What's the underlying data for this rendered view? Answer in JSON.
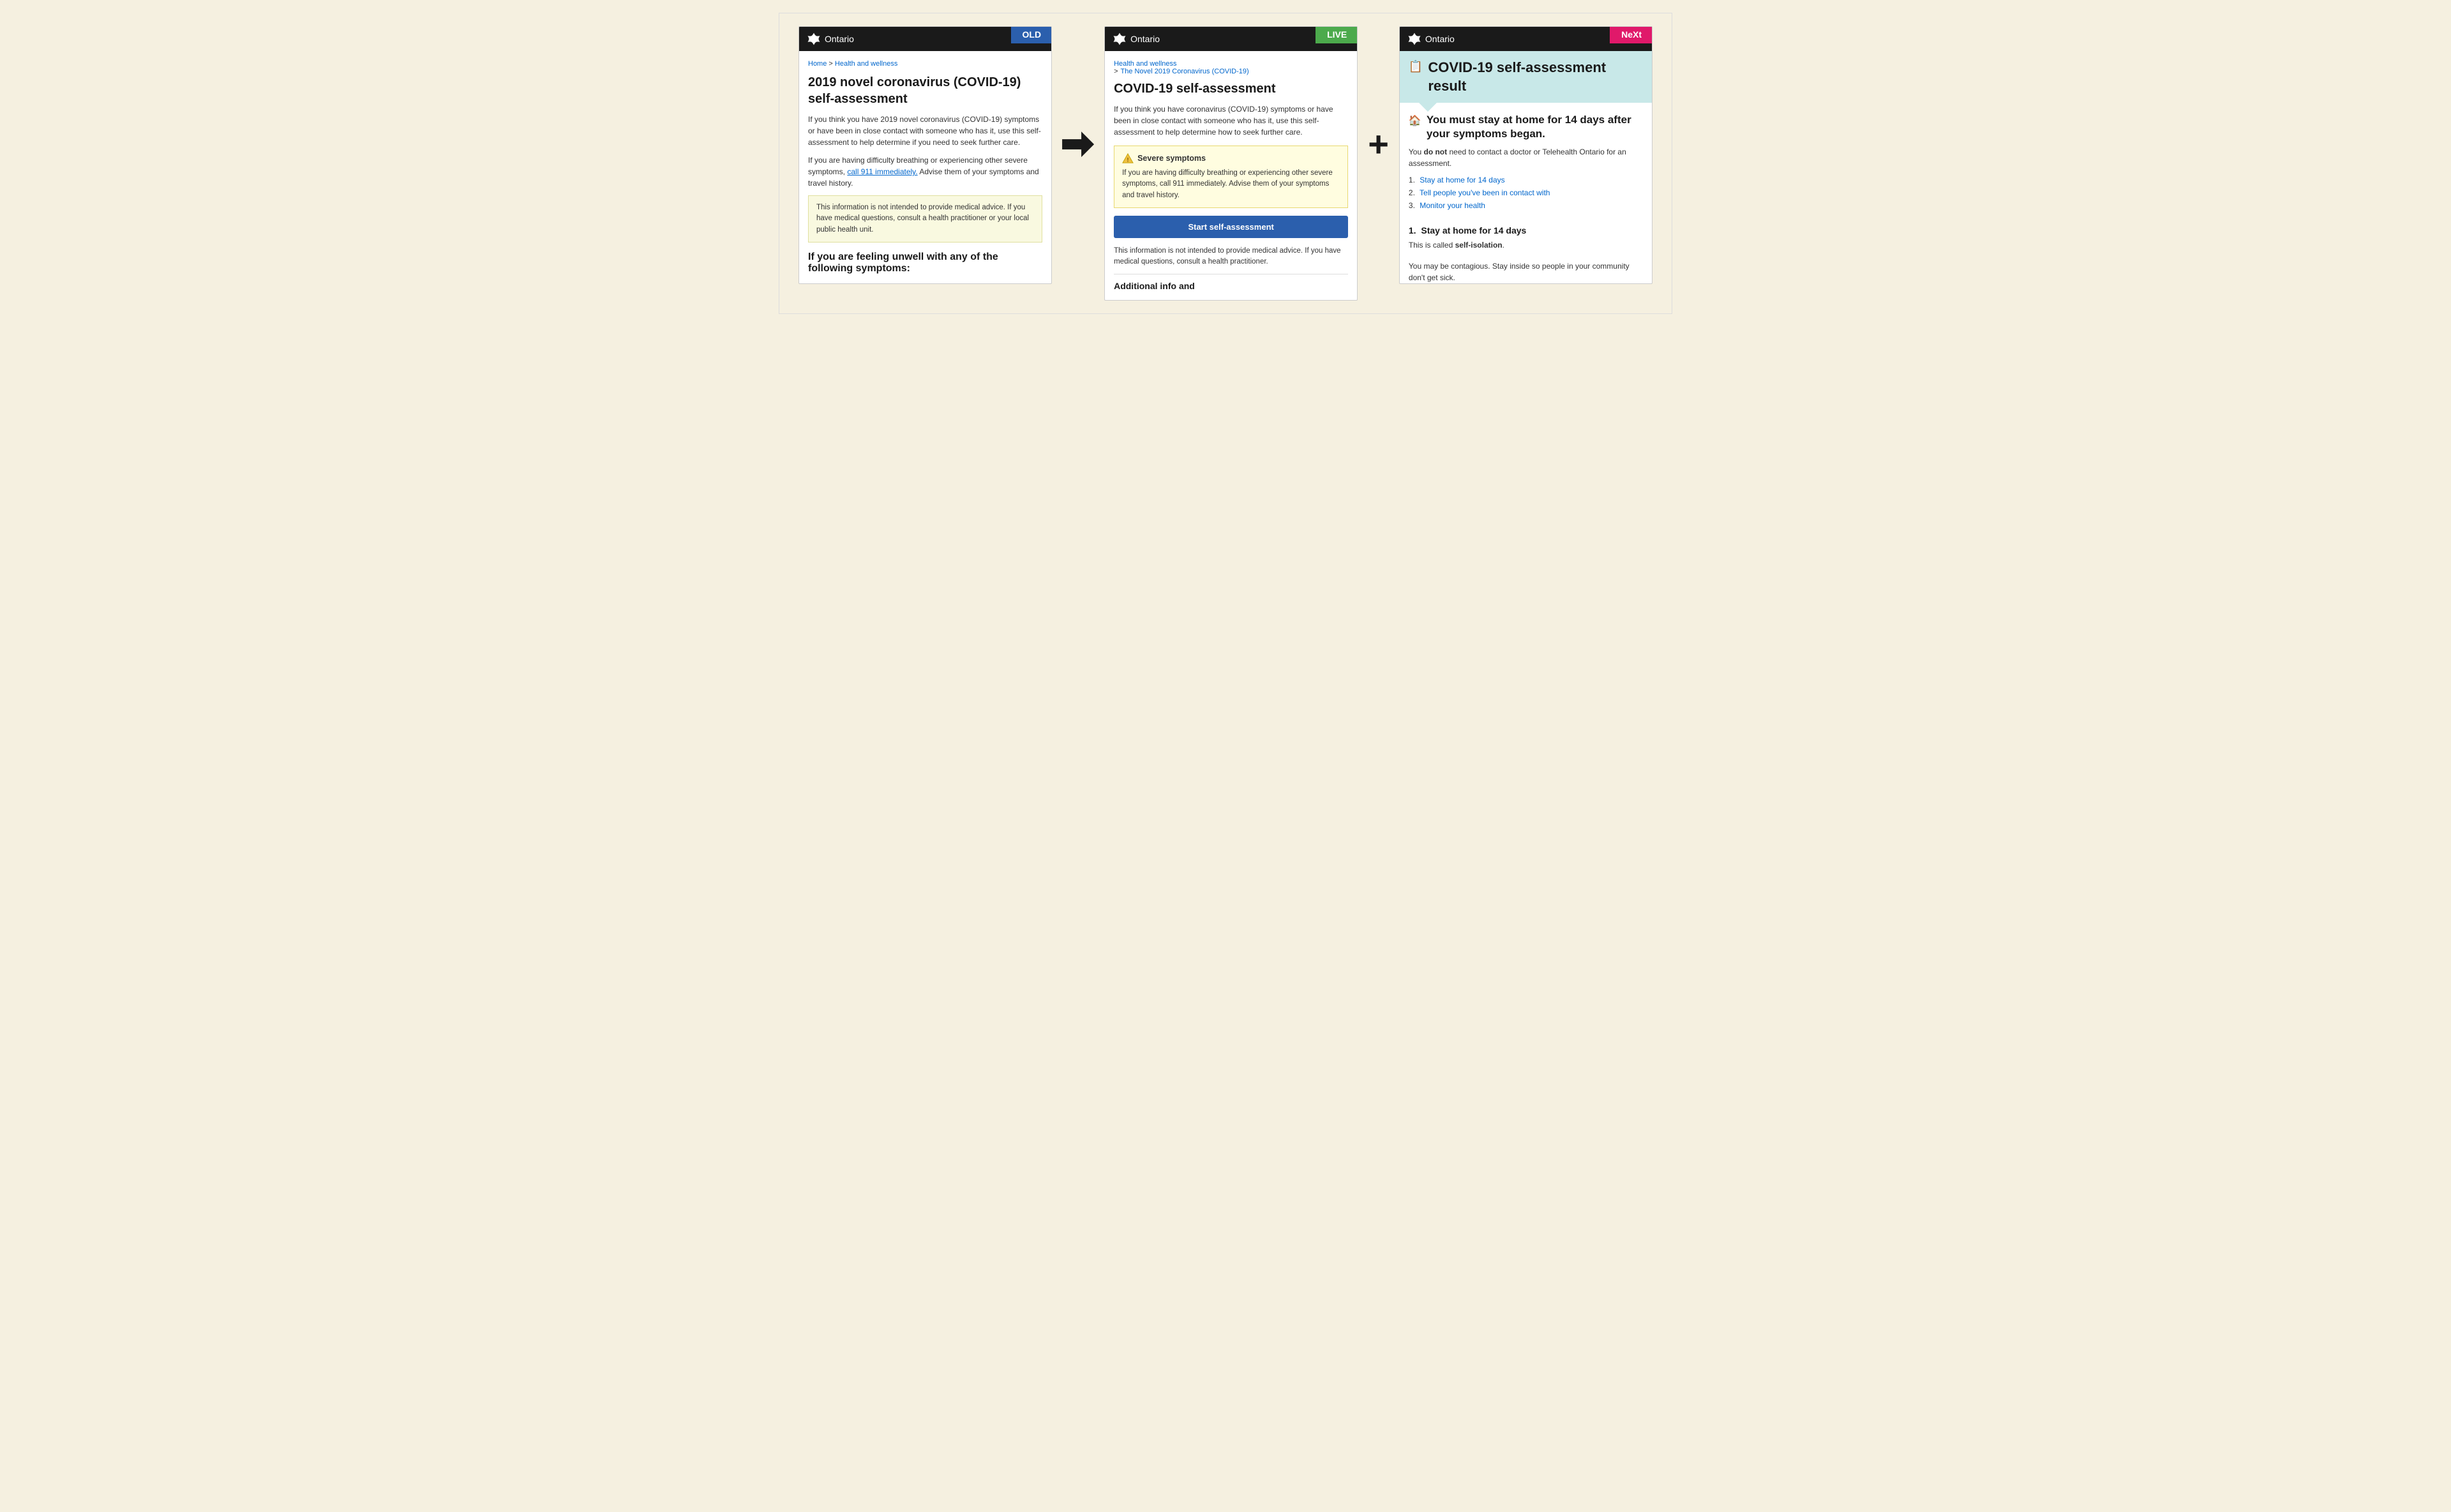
{
  "panels": {
    "old": {
      "badge": "OLD",
      "header_title": "Ontario",
      "breadcrumb_home": "Home",
      "breadcrumb_section": "Health and wellness",
      "title": "2019 novel coronavirus (COVID-19) self-assessment",
      "intro1": "If you think you have 2019 novel coronavirus (COVID-19) symptoms or have been in close contact with someone who has it, use this self-assessment to help determine if you need to seek further care.",
      "intro2_prefix": "If you are having difficulty breathing or experiencing other severe symptoms,",
      "intro2_link": "call 911 immediately.",
      "intro2_suffix": "Advise them of your symptoms and travel history.",
      "yellow_box": "This information is not intended to provide medical advice. If you have medical questions, consult a health practitioner or your local public health unit.",
      "section_title": "If you are feeling unwell with any of the following symptoms:"
    },
    "live": {
      "badge": "LIVE",
      "header_title": "Ontario",
      "breadcrumb_section": "Health and wellness",
      "breadcrumb_sub": "The Novel 2019 Coronavirus (COVID-19)",
      "title": "COVID-19 self-assessment",
      "intro": "If you think you have coronavirus (COVID-19) symptoms or have been in close contact with someone who has it, use this self-assessment to help determine how to seek further care.",
      "severe_title": "Severe symptoms",
      "severe_body": "If you are having difficulty breathing or experiencing other severe symptoms, call 911 immediately. Advise them of your symptoms and travel history.",
      "start_btn": "Start self-assessment",
      "footer_text": "This information is not intended to provide medical advice. If you have medical questions, consult a health practitioner.",
      "additional_title": "Additional info and"
    },
    "next": {
      "badge": "NeXt",
      "header_title": "Ontario",
      "page_title": "COVID-19 self-assessment result",
      "stay_home_heading": "You must stay at home for 14 days after your symptoms began.",
      "stay_home_body1_pre": "You ",
      "stay_home_body1_bold": "do not",
      "stay_home_body1_post": " need to contact a doctor or Telehealth Ontario for an assessment.",
      "list_items": [
        {
          "num": "1.",
          "text": "Stay at home for 14 days"
        },
        {
          "num": "2.",
          "text": "Tell people you've been in contact with"
        },
        {
          "num": "3.",
          "text": "Monitor your health"
        }
      ],
      "section1_num": "1.",
      "section1_title": "Stay at home for 14 days",
      "section1_body1_pre": "This is called ",
      "section1_body1_bold": "self-isolation",
      "section1_body1_post": ".",
      "section1_body2": "You may be contagious. Stay inside so people in your community don't get sick."
    }
  }
}
